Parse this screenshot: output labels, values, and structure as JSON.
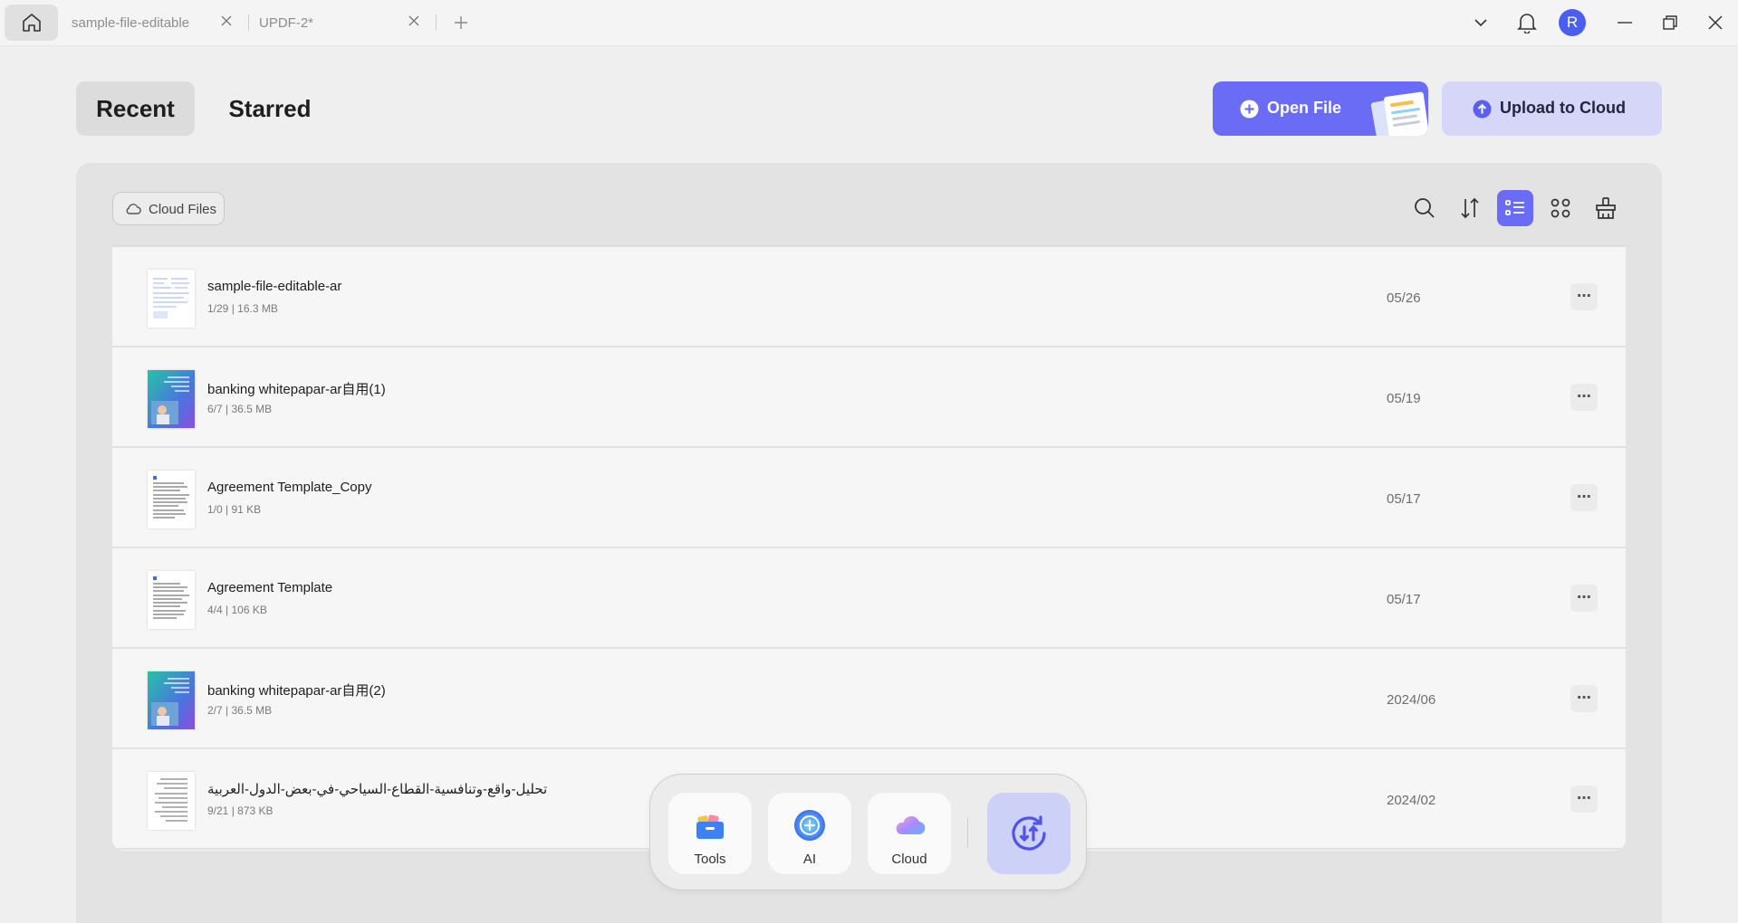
{
  "titlebar": {
    "tabs": [
      {
        "label": "sample-file-editable"
      },
      {
        "label": "UPDF-2*"
      }
    ],
    "avatar_initial": "R"
  },
  "header": {
    "tabs": {
      "recent": "Recent",
      "starred": "Starred"
    },
    "open_file_label": "Open File",
    "upload_label": "Upload to Cloud"
  },
  "panel": {
    "cloud_files_label": "Cloud Files",
    "toolbar_icons": [
      "search-icon",
      "sort-icon",
      "list-view-icon",
      "grid-view-icon",
      "clean-icon"
    ]
  },
  "files": [
    {
      "name": "sample-file-editable-ar",
      "meta": "1/29 | 16.3 MB",
      "date": "05/26",
      "thumb": "doc-blue"
    },
    {
      "name": "banking whitepapar-ar自用(1)",
      "meta": "6/7 | 36.5 MB",
      "date": "05/19",
      "thumb": "cover"
    },
    {
      "name": "Agreement Template_Copy",
      "meta": "1/0 | 91 KB",
      "date": "05/17",
      "thumb": "doc"
    },
    {
      "name": "Agreement Template",
      "meta": "4/4 | 106 KB",
      "date": "05/17",
      "thumb": "doc"
    },
    {
      "name": "banking whitepapar-ar自用(2)",
      "meta": "2/7 | 36.5 MB",
      "date": "2024/06",
      "thumb": "cover"
    },
    {
      "name": "تحليل-واقع-وتنافسية-القطاع-السياحي-في-بعض-الدول-العربية",
      "meta": "9/21 | 873 KB",
      "date": "2024/02",
      "thumb": "doc-ar"
    }
  ],
  "dock": {
    "tools_label": "Tools",
    "ai_label": "AI",
    "cloud_label": "Cloud"
  },
  "colors": {
    "accent": "#6a6cf6",
    "accent_light": "#d5d6f8",
    "avatar": "#4a5ff2"
  }
}
